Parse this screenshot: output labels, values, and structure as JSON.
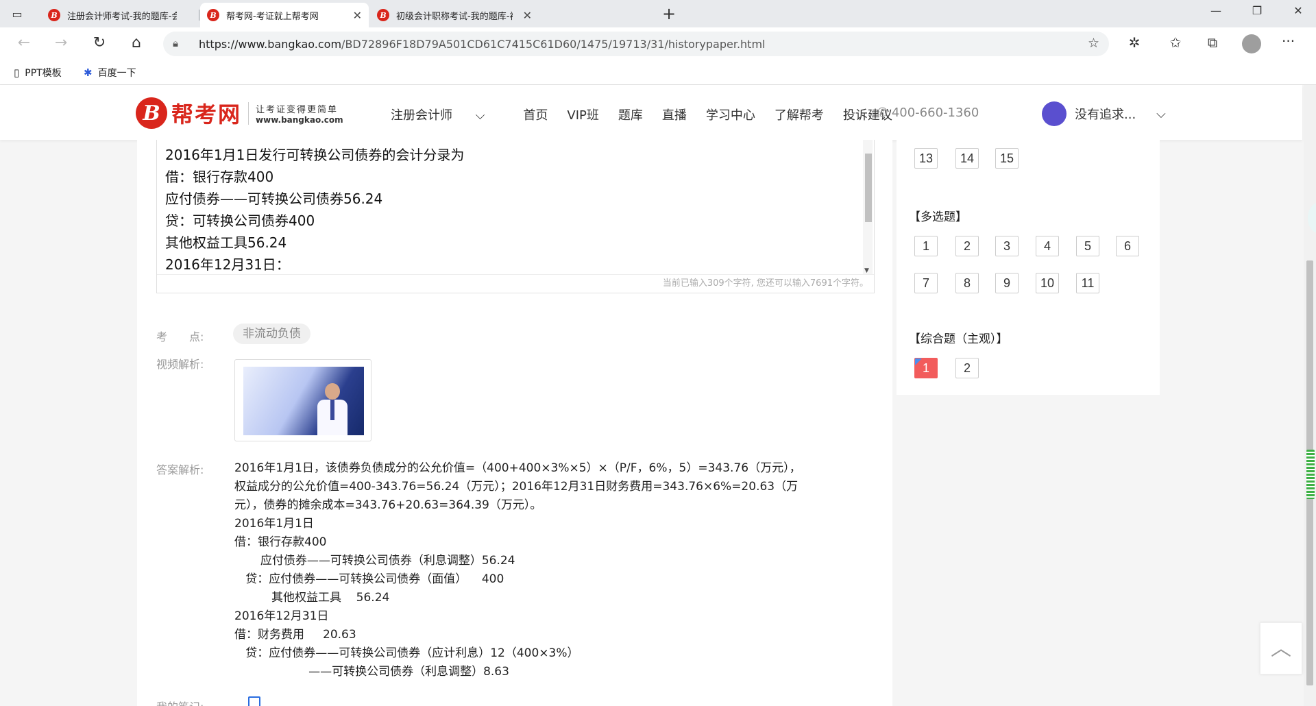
{
  "browser": {
    "tabs": [
      {
        "title": "注册会计师考试-我的题库-会计-",
        "active": false
      },
      {
        "title": "帮考网-考证就上帮考网",
        "active": true
      },
      {
        "title": "初级会计职称考试-我的题库-初级",
        "active": false
      }
    ],
    "url_host": "https://www.bangkao.com",
    "url_path": "/BD72896F18D79A501CD61C7415C61D60/1475/19713/31/historypaper.html",
    "bookmarks": [
      {
        "label": "PPT模板",
        "icon": "document-icon"
      },
      {
        "label": "百度一下",
        "icon": "paw-icon"
      }
    ]
  },
  "site": {
    "logo_name": "帮考网",
    "tagline": "让考证变得更简单",
    "domain": "www.bangkao.com",
    "nav": [
      "注册会计师",
      "首页",
      "VIP班",
      "题库",
      "直播",
      "学习中心",
      "了解帮考",
      "投诉建议"
    ],
    "nav_dropdown_icon": "chevron-down-icon",
    "phone": "400-660-1360",
    "username": "没有追求..."
  },
  "editor": {
    "lines": [
      "2016年1月1日发行可转换公司债券的会计分录为",
      "借：银行存款400",
      "应付债券——可转换公司债券56.24",
      "贷：可转换公司债券400",
      "其他权益工具56.24",
      "2016年12月31日："
    ],
    "counter": "当前已输入309个字符, 您还可以输入7691个字符。"
  },
  "question": {
    "kp_label": "考　　点:",
    "kp_tag": "非流动负债",
    "video_label": "视频解析:",
    "analysis_label": "答案解析:",
    "analysis_para": "2016年1月1日，该债券负债成分的公允价值=（400+400×3%×5）×（P/F，6%，5）=343.76（万元），权益成分的公允价值=400-343.76=56.24（万元）；2016年12月31日财务费用=343.76×6%=20.63（万元），债券的摊余成本=343.76+20.63=364.39（万元）。",
    "analysis_lines": [
      "2016年1月1日",
      "借：银行存款400",
      "       应付债券——可转换公司债券（利息调整）56.24",
      "   贷：应付债券——可转换公司债券（面值）    400",
      "          其他权益工具    56.24",
      "2016年12月31日",
      "借：财务费用     20.63",
      "   贷：应付债券——可转换公司债券（应计利息）12（400×3%）",
      "                    ——可转换公司债券（利息调整）8.63"
    ],
    "note_label": "我的笔记:"
  },
  "sidebar": {
    "single_row": [
      "13",
      "14",
      "15"
    ],
    "multi_title": "【多选题】",
    "multi_row1": [
      "1",
      "2",
      "3",
      "4",
      "5",
      "6"
    ],
    "multi_row2": [
      "7",
      "8",
      "9",
      "10",
      "11"
    ],
    "comp_title": "【综合题（主观）】",
    "comp_items": [
      "1",
      "2"
    ],
    "answered_color": "#f25c5c"
  },
  "colors": {
    "brand": "#d9261c"
  }
}
